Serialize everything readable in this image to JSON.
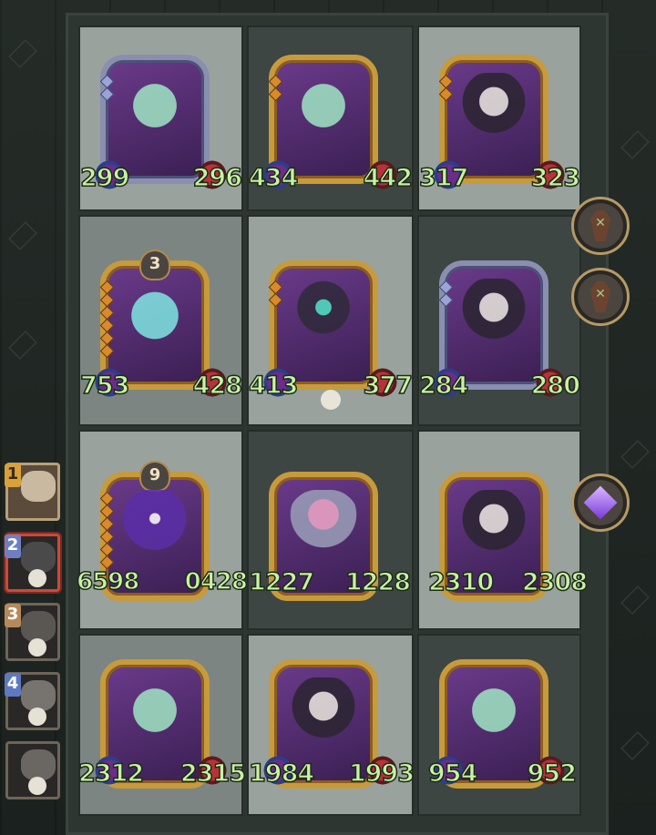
{
  "board": {
    "rows": [
      [
        {
          "attack": "299",
          "health": "296",
          "frame": "silver",
          "art": "ghost-cat",
          "level": ""
        },
        {
          "attack": "434",
          "health": "442",
          "frame": "gold",
          "art": "ghost-vampire",
          "level": ""
        },
        {
          "attack": "317",
          "health": "323",
          "frame": "gold",
          "art": "reaper",
          "level": ""
        }
      ],
      [
        {
          "attack": "753",
          "health": "428",
          "frame": "gold",
          "art": "spectral-wolf",
          "level": "3"
        },
        {
          "attack": "413",
          "health": "377",
          "frame": "gold",
          "art": "horned-devil",
          "level": ""
        },
        {
          "attack": "284",
          "health": "280",
          "frame": "silver",
          "art": "zombie-skull",
          "level": ""
        }
      ],
      [
        {
          "attack": "6598",
          "health": "0428",
          "frame": "gold",
          "art": "purple-demon-boss",
          "level": "9"
        },
        {
          "attack": "1227",
          "health": "1228",
          "frame": "gold",
          "art": "pink-haired-knight",
          "level": ""
        },
        {
          "attack": "2310",
          "health": "2308",
          "frame": "gold",
          "art": "reaper",
          "level": ""
        }
      ],
      [
        {
          "attack": "2312",
          "health": "2315",
          "frame": "gold",
          "art": "ghost-vampire",
          "level": ""
        },
        {
          "attack": "1984",
          "health": "1993",
          "frame": "gold",
          "art": "reaper",
          "level": ""
        },
        {
          "attack": "954",
          "health": "952",
          "frame": "gold",
          "art": "ghost-cat",
          "level": ""
        }
      ]
    ]
  },
  "side_buttons": [
    {
      "icon": "coffin-icon"
    },
    {
      "icon": "coffin-icon"
    },
    {
      "icon": "gem-icon"
    }
  ],
  "queue": {
    "items": [
      {
        "num": "1",
        "state": "active"
      },
      {
        "num": "2",
        "state": "selected"
      },
      {
        "num": "3",
        "state": "dead"
      },
      {
        "num": "4",
        "state": "dead"
      },
      {
        "num": "",
        "state": "dead"
      }
    ]
  },
  "colors": {
    "stat_text": "#c8f2a4",
    "gold_frame": "#c79a3c",
    "silver_frame": "#8a8fb0",
    "selected_border": "#c84a3c"
  }
}
